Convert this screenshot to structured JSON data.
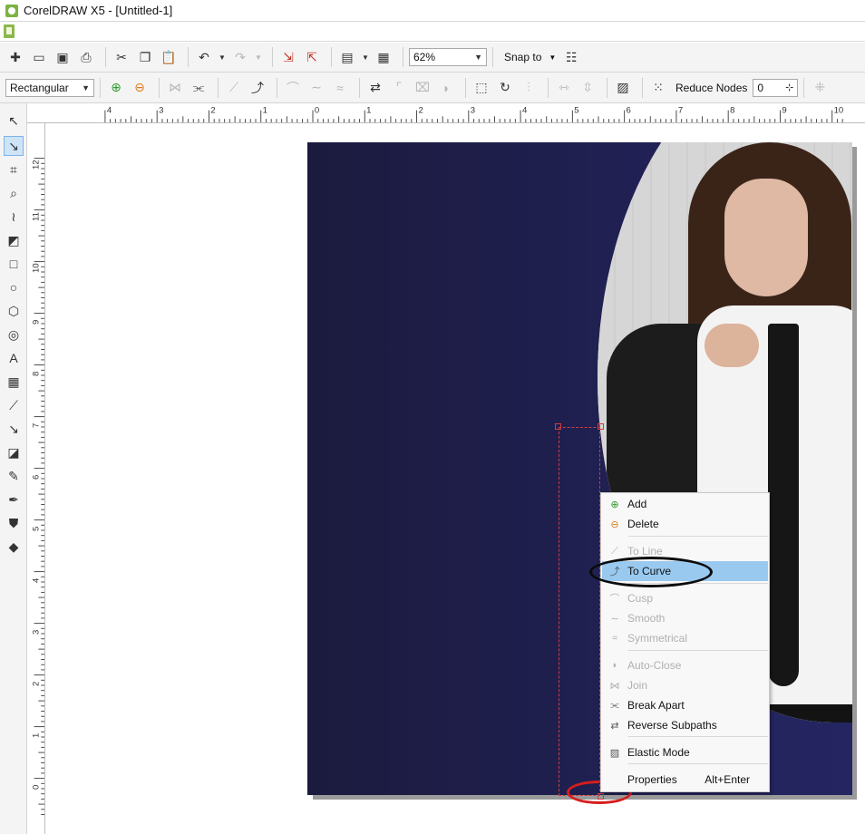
{
  "window": {
    "title": "CorelDRAW X5 - [Untitled-1]"
  },
  "toolbar1": {
    "zoom": "62%",
    "snap_label": "Snap to",
    "buttons": [
      "new-document-icon",
      "open-icon",
      "save-icon",
      "print-icon",
      "cut-icon",
      "copy-icon",
      "paste-icon",
      "undo-icon",
      "redo-icon",
      "import-icon",
      "export-icon",
      "application-launcher-icon",
      "welcome-screen-icon",
      "options-icon"
    ]
  },
  "toolbar2": {
    "selection_mode": "Rectangular",
    "reduce_nodes_label": "Reduce Nodes",
    "reduce_nodes_value": "0"
  },
  "rulers": {
    "horizontal": [
      "4",
      "3",
      "2",
      "1",
      "0",
      "1",
      "2",
      "3",
      "4",
      "5",
      "6",
      "7",
      "8",
      "9",
      "10"
    ],
    "vertical": [
      "12",
      "11",
      "10",
      "9",
      "8",
      "7",
      "6",
      "5",
      "4",
      "3",
      "2",
      "1",
      "0"
    ]
  },
  "context_menu": {
    "items": [
      {
        "label": "Add",
        "icon": "add-node-icon",
        "enabled": true
      },
      {
        "label": "Delete",
        "icon": "delete-node-icon",
        "enabled": true
      },
      {
        "label": "To Line",
        "icon": "to-line-icon",
        "enabled": false
      },
      {
        "label": "To Curve",
        "icon": "to-curve-icon",
        "enabled": true,
        "highlighted": true
      },
      {
        "label": "Cusp",
        "icon": "cusp-icon",
        "enabled": false
      },
      {
        "label": "Smooth",
        "icon": "smooth-icon",
        "enabled": false
      },
      {
        "label": "Symmetrical",
        "icon": "symmetrical-icon",
        "enabled": false
      },
      {
        "label": "Auto-Close",
        "icon": "auto-close-icon",
        "enabled": false
      },
      {
        "label": "Join",
        "icon": "join-icon",
        "enabled": false
      },
      {
        "label": "Break Apart",
        "icon": "break-apart-icon",
        "enabled": true
      },
      {
        "label": "Reverse Subpaths",
        "icon": "reverse-subpaths-icon",
        "enabled": true
      },
      {
        "label": "Elastic Mode",
        "icon": "elastic-mode-icon",
        "enabled": true
      },
      {
        "label": "Properties",
        "shortcut": "Alt+Enter",
        "enabled": true
      }
    ]
  },
  "colors": {
    "page_bg": "#202052",
    "highlight": "#99c9ef",
    "annotation_red": "#d71d1d"
  }
}
